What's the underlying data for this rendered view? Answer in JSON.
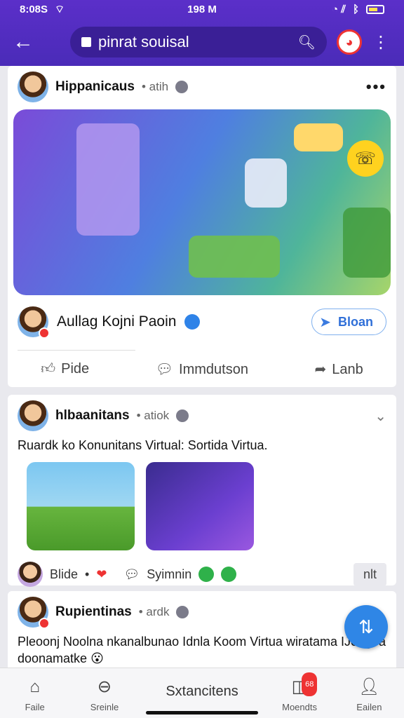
{
  "status_bar": {
    "time_left": "8:08S",
    "time_center": "198 M"
  },
  "app_bar": {
    "search_text": "pinrat souisal"
  },
  "post1": {
    "username": "Hippanicaus",
    "meta": "• atih",
    "author": "Aullag Kojni Paoin",
    "follow_label": "Bloan",
    "actions": [
      "Pide",
      "Immdutson",
      "Lanb"
    ]
  },
  "post2": {
    "username": "hlbaanitans",
    "meta": "• atiok",
    "text": "Ruardk ko Konunitans Virtual: Sortida Virtua.",
    "reaction_label": "Blide",
    "comment_label": "Syimnin",
    "nlt_label": "nlt"
  },
  "post3": {
    "username": "Rupientinas",
    "meta": "• ardk",
    "text": "Pleoonj Noolna nkanalbunao Idnla Koom Virtua wiratama IJengoa doonamatke 😮"
  },
  "bottom_nav": {
    "items": [
      "Faile",
      "Sreinle",
      "Sxtancitens",
      "Moendts",
      "Eailen"
    ],
    "badge": "68"
  },
  "colors": {
    "brand": "#4a2bb8",
    "accent": "#2f86e6"
  },
  "icons": [
    "back-arrow-icon",
    "lock-icon",
    "search-icon",
    "profile-icon",
    "kebab-icon"
  ]
}
